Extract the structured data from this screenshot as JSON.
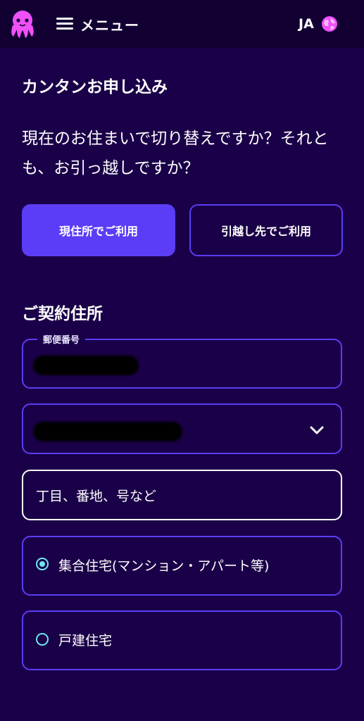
{
  "header": {
    "logo_icon": "octopus-logo-icon",
    "menu_label": "メニュー",
    "language_label": "JA",
    "language_icon": "globe-icon"
  },
  "main": {
    "title": "カンタンお申し込み",
    "question": "現在のお住まいで切り替えですか？それとも、お引っ越しですか？",
    "options": {
      "current_address": "現住所でご利用",
      "moving_address": "引越し先でご利用"
    },
    "contract_address": {
      "title": "ご契約住所",
      "postal_code_label": "郵便番号",
      "street_placeholder": "丁目、番地、号など"
    },
    "building_type": {
      "options": [
        {
          "label": "集合住宅(マンション・アパート等)",
          "selected": true
        },
        {
          "label": "戸建住宅",
          "selected": false
        }
      ]
    }
  },
  "colors": {
    "background": "#1a0048",
    "header_background": "#120033",
    "accent": "#5b3df7",
    "radio": "#6fe7f3",
    "logo": "#f050f8"
  }
}
